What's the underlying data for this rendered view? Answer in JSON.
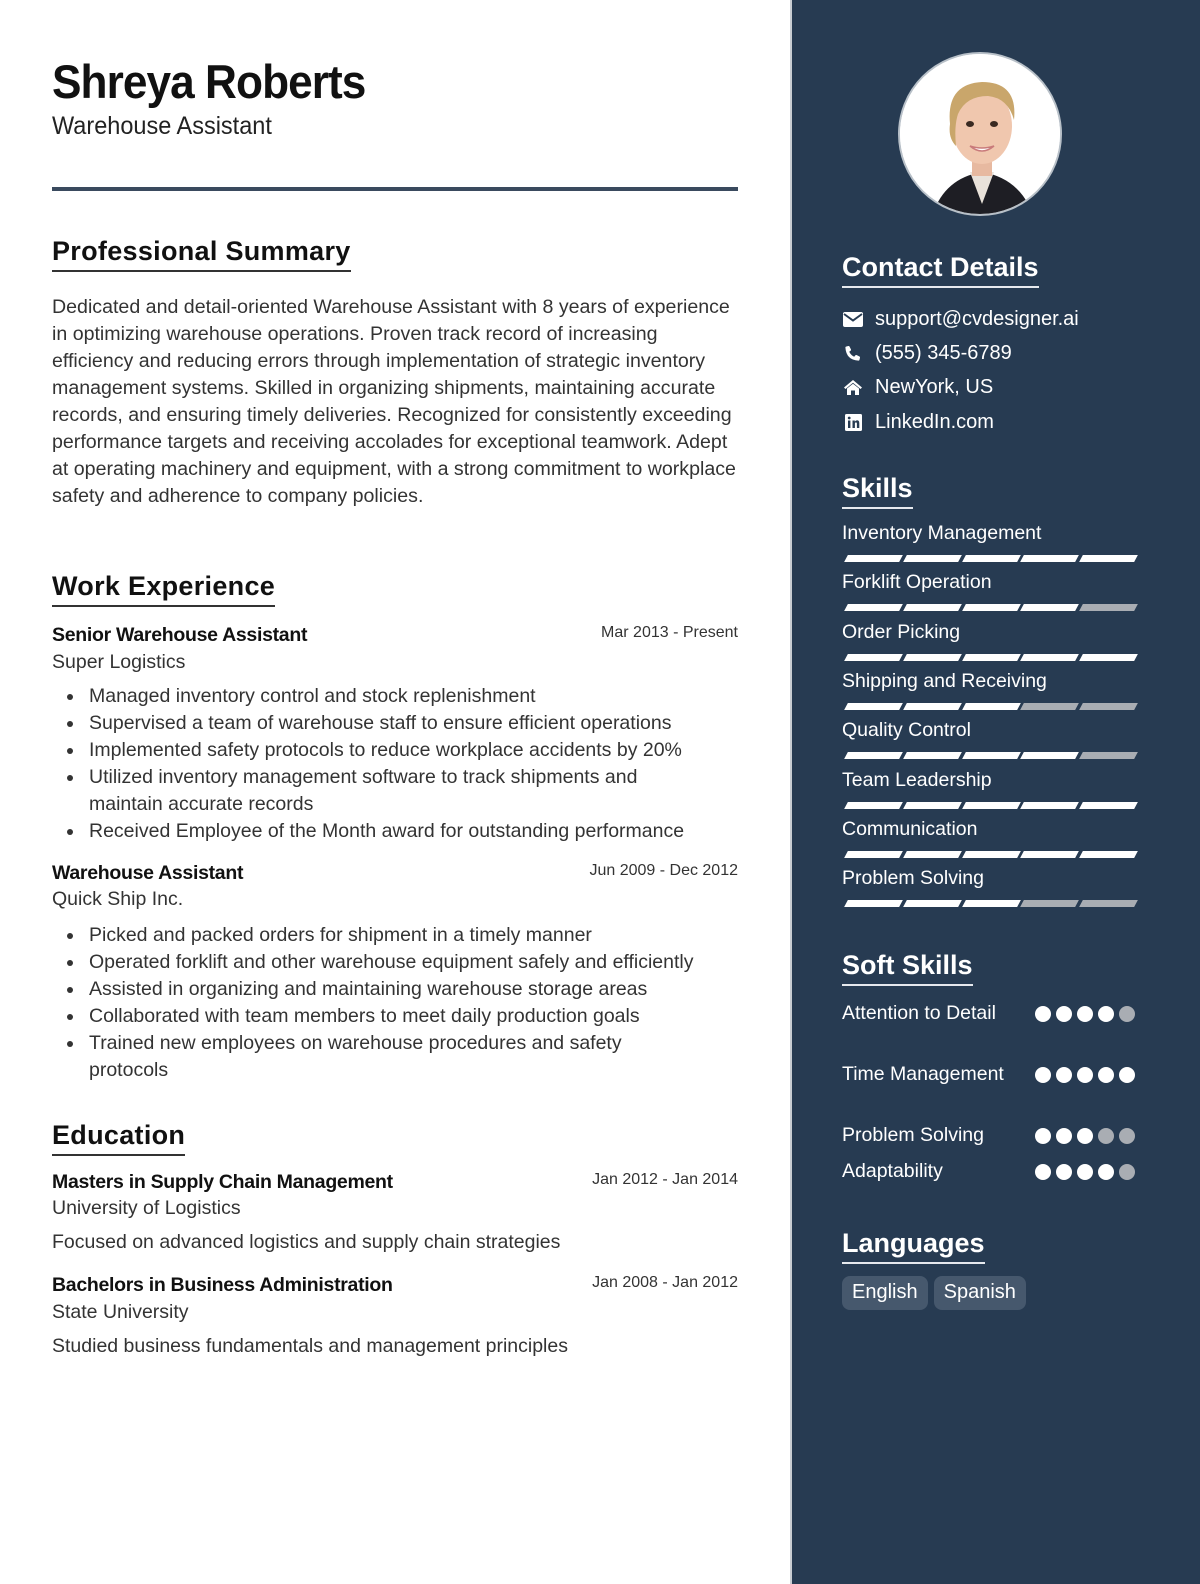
{
  "header": {
    "name": "Shreya Roberts",
    "title": "Warehouse Assistant"
  },
  "summary": {
    "heading": "Professional Summary",
    "text": "Dedicated and detail-oriented Warehouse Assistant with 8 years of experience in optimizing warehouse operations. Proven track record of increasing efficiency and reducing errors through implementation of strategic inventory management systems. Skilled in organizing shipments, maintaining accurate records, and ensuring timely deliveries. Recognized for consistently exceeding performance targets and receiving accolades for exceptional teamwork. Adept at operating machinery and equipment, with a strong commitment to workplace safety and adherence to company policies."
  },
  "experience": {
    "heading": "Work Experience",
    "jobs": [
      {
        "title": "Senior Warehouse Assistant",
        "dates": "Mar 2013 - Present",
        "company": "Super Logistics",
        "bullets": [
          "Managed inventory control and stock replenishment",
          "Supervised a team of warehouse staff to ensure efficient operations",
          "Implemented safety protocols to reduce workplace accidents by 20%",
          "Utilized inventory management software to track shipments and maintain accurate records",
          "Received Employee of the Month award for outstanding performance"
        ]
      },
      {
        "title": "Warehouse Assistant",
        "dates": "Jun 2009 - Dec 2012",
        "company": "Quick Ship Inc.",
        "bullets": [
          "Picked and packed orders for shipment in a timely manner",
          "Operated forklift and other warehouse equipment safely and efficiently",
          "Assisted in organizing and maintaining warehouse storage areas",
          "Collaborated with team members to meet daily production goals",
          "Trained new employees on warehouse procedures and safety protocols"
        ]
      }
    ]
  },
  "education": {
    "heading": "Education",
    "items": [
      {
        "degree": "Masters in Supply Chain Management",
        "dates": "Jan 2012 - Jan 2014",
        "school": "University of Logistics",
        "description": "Focused on advanced logistics and supply chain strategies"
      },
      {
        "degree": "Bachelors in Business Administration",
        "dates": "Jan 2008 - Jan 2012",
        "school": "State University",
        "description": "Studied business fundamentals and management principles"
      }
    ]
  },
  "sidebar": {
    "photo_alt": "Profile photo",
    "contact": {
      "heading": "Contact Details",
      "items": [
        {
          "icon": "envelope-icon",
          "text": "support@cvdesigner.ai"
        },
        {
          "icon": "phone-icon",
          "text": "(555) 345-6789"
        },
        {
          "icon": "home-icon",
          "text": "NewYork, US"
        },
        {
          "icon": "linkedin-icon",
          "text": "LinkedIn.com"
        }
      ]
    },
    "skills": {
      "heading": "Skills",
      "max": 5,
      "items": [
        {
          "label": "Inventory Management",
          "level": 5
        },
        {
          "label": "Forklift Operation",
          "level": 4
        },
        {
          "label": "Order Picking",
          "level": 5
        },
        {
          "label": "Shipping and Receiving",
          "level": 3
        },
        {
          "label": "Quality Control",
          "level": 4
        },
        {
          "label": "Team Leadership",
          "level": 5
        },
        {
          "label": "Communication",
          "level": 5
        },
        {
          "label": "Problem Solving",
          "level": 3
        }
      ]
    },
    "soft_skills": {
      "heading": "Soft Skills",
      "max": 5,
      "items": [
        {
          "label": "Attention to Detail",
          "level": 4
        },
        {
          "label": "Time Management",
          "level": 5
        },
        {
          "label": "Problem Solving",
          "level": 3
        },
        {
          "label": "Adaptability",
          "level": 4
        }
      ]
    },
    "languages": {
      "heading": "Languages",
      "items": [
        "English",
        "Spanish"
      ]
    }
  },
  "colors": {
    "sidebar_bg": "#273b52",
    "accent_rule": "#3a4a5e",
    "rating_on": "#ffffff",
    "rating_off": "#a9adb3",
    "chip_bg": "#46586d"
  }
}
